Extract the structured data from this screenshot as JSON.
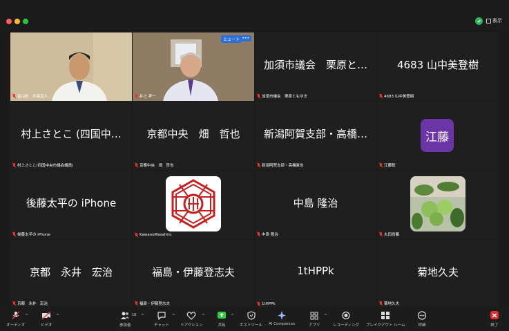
{
  "window": {
    "view_label": "表示"
  },
  "tiles": [
    {
      "big": "",
      "caption": "富山県　永森直人"
    },
    {
      "big": "",
      "caption": "井上 孝一",
      "mute_badge": "ミュート",
      "more_badge": "•••"
    },
    {
      "big": "加須市議会　栗原と…",
      "caption": "加須市議会　栗原ともゆき"
    },
    {
      "big": "4683 山中美登樹",
      "caption": "4683 山中美登樹"
    },
    {
      "big": "村上さとこ (四国中…",
      "caption": "村上さとこ(四国中央市議会議員)"
    },
    {
      "big": "京都中央　畑　哲也",
      "caption": "京都中央　畑　哲也"
    },
    {
      "big": "新潟阿賀支部・高橋…",
      "caption": "新潟阿賀支部・高橋眞也"
    },
    {
      "avatar": "江藤",
      "caption": "江藤聡"
    },
    {
      "big": "後藤太平の iPhone",
      "caption": "後藤太平の iPhone"
    },
    {
      "big": "",
      "caption": "KawanoMasahiro"
    },
    {
      "big": "中島 隆治",
      "caption": "中島 隆治"
    },
    {
      "big": "",
      "caption": "丸田尚義"
    },
    {
      "big": "京都　永井　宏治",
      "caption": "京都　永井　宏治"
    },
    {
      "big": "福島・伊藤登志夫",
      "caption": "福島・伊藤登志夫"
    },
    {
      "big": "1tHPPk",
      "caption": "1tHPPk"
    },
    {
      "big": "菊地久夫",
      "caption": "菊地久夫"
    }
  ],
  "toolbar": {
    "audio": "オーディオ",
    "video": "ビデオ",
    "participants": "参加者",
    "participants_count": "16",
    "chat": "チャット",
    "reactions": "リアクション",
    "share": "共有",
    "host_tools": "ホストツール",
    "ai_companion": "AI Companion",
    "apps": "アプリ",
    "recording": "レコーディング",
    "breakout": "ブレイクアウト ルーム",
    "more": "詳細",
    "end": "終了"
  },
  "colors": {
    "active_speaker": "#2ecc40",
    "end_button": "#e02b2b",
    "avatar_bg": "#6b35a8",
    "badge": "#2f6fd6"
  }
}
